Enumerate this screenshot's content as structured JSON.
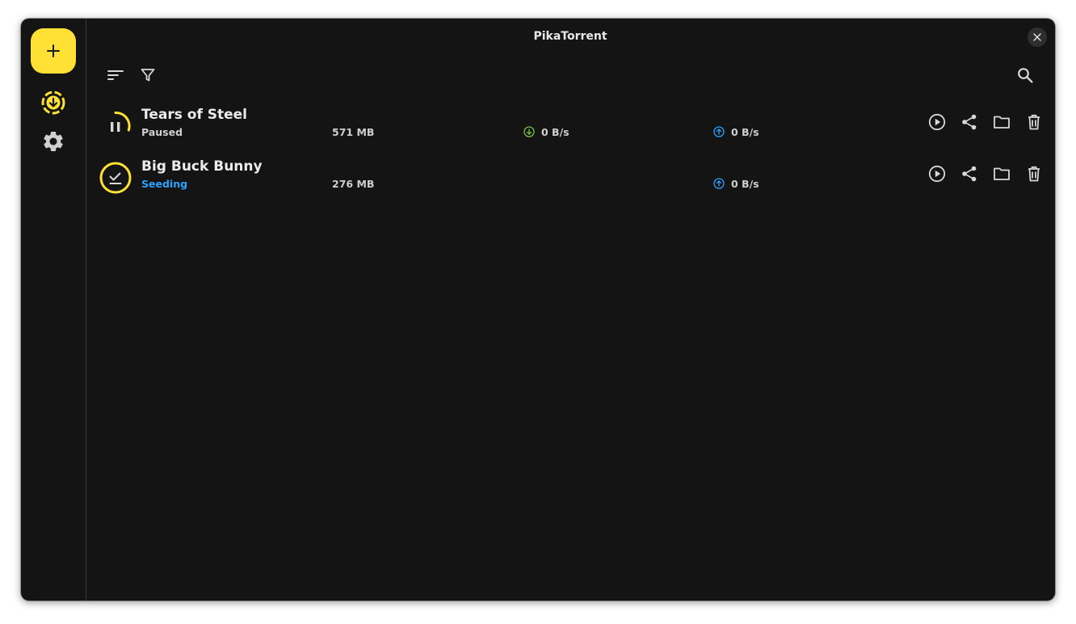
{
  "window": {
    "title": "PikaTorrent"
  },
  "colors": {
    "accent": "#ffe135",
    "background": "#141414",
    "seeding": "#29a3ff",
    "download": "#7cc242",
    "upload": "#29a3ff",
    "text": "#ececec"
  },
  "sidebar": {
    "add_icon": "plus-icon",
    "items": [
      {
        "icon": "downloads-icon",
        "active": true
      },
      {
        "icon": "gear-icon",
        "active": false
      }
    ]
  },
  "toolbar": {
    "sort_icon": "sort-icon",
    "filter_icon": "filter-icon",
    "search_icon": "search-icon"
  },
  "torrents": [
    {
      "name": "Tears of Steel",
      "status": "Paused",
      "status_color": "#cfcfcf",
      "size": "571 MB",
      "download_speed": "0 B/s",
      "upload_speed": "0 B/s",
      "state_icon": "pause-icon"
    },
    {
      "name": "Big Buck Bunny",
      "status": "Seeding",
      "status_color": "#29a3ff",
      "size": "276 MB",
      "upload_speed": "0 B/s",
      "state_icon": "check-icon"
    }
  ]
}
